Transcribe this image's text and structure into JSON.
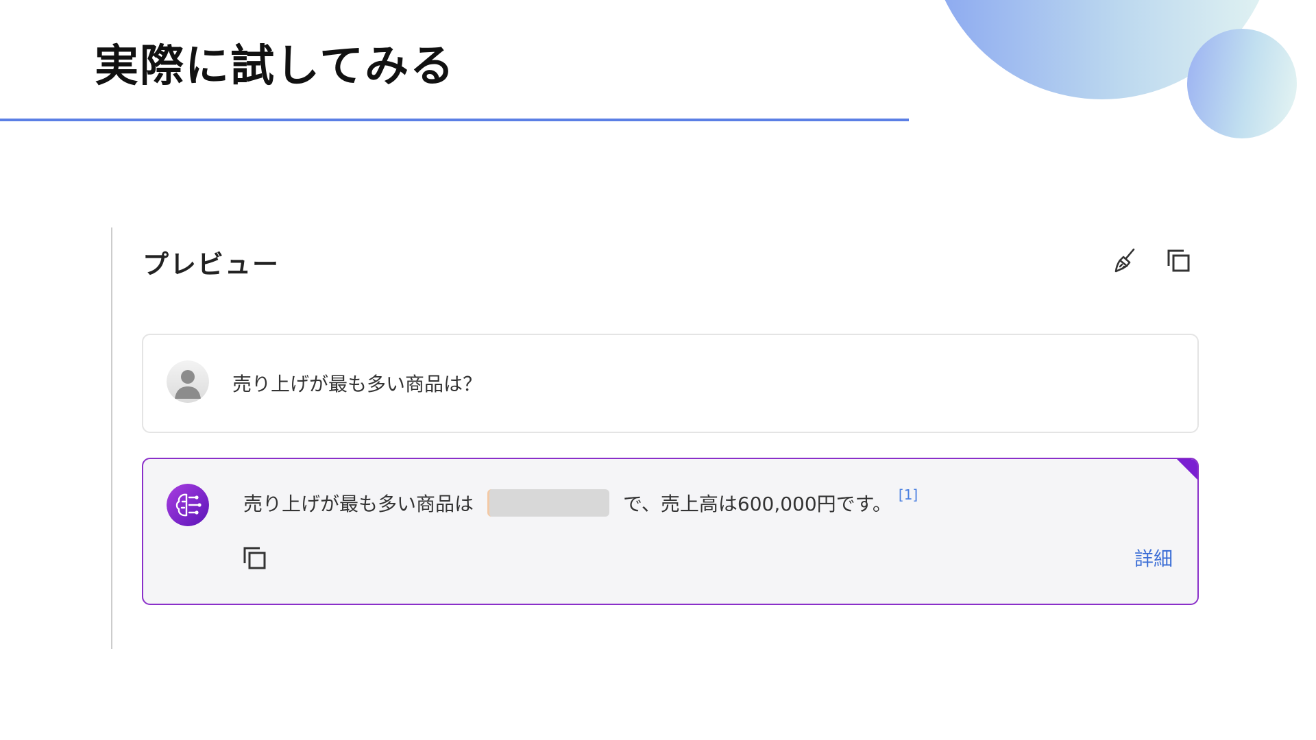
{
  "slide": {
    "title": "実際に試してみる"
  },
  "preview": {
    "title": "プレビュー",
    "toolbar_icons": [
      "broom-icon",
      "copy-icon"
    ]
  },
  "user_message": {
    "avatar_icon": "user-avatar-icon",
    "text": "売り上げが最も多い商品は？"
  },
  "bot_message": {
    "avatar_icon": "ai-brain-icon",
    "text_before": "売り上げが最も多い商品は",
    "text_after": "で、売上高は600,000円です。",
    "citation": "[1]",
    "copy_icon": "copy-icon",
    "details_label": "詳細"
  },
  "colors": {
    "accent_rule": "#5b7fe5",
    "bot_border": "#8a2fc9",
    "link": "#3d6fd6"
  }
}
